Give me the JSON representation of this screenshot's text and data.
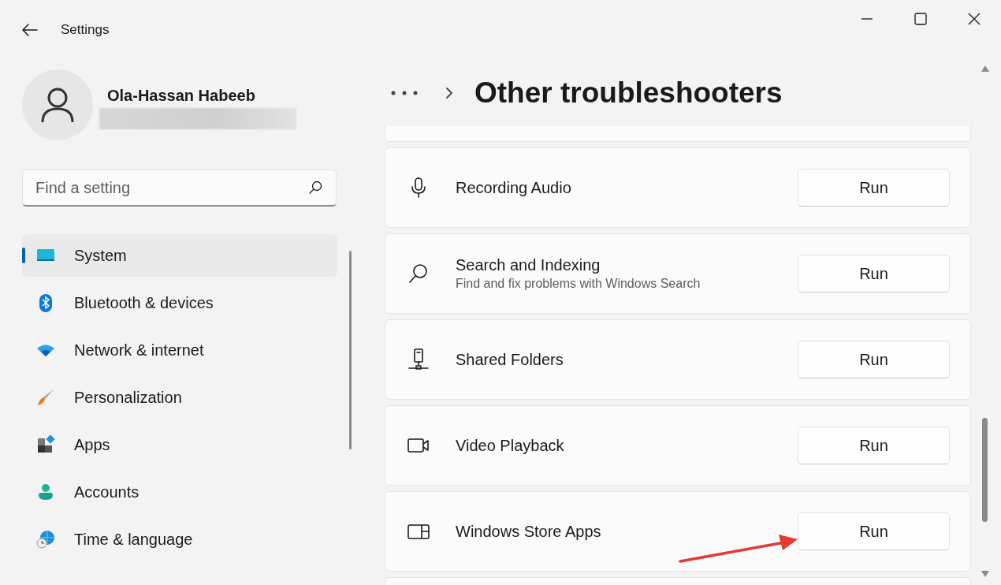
{
  "window": {
    "title": "Settings"
  },
  "profile": {
    "name": "Ola-Hassan Habeeb"
  },
  "search": {
    "placeholder": "Find a setting"
  },
  "nav": [
    {
      "kind": "system",
      "label": "System",
      "selected": true
    },
    {
      "kind": "bluetooth",
      "label": "Bluetooth & devices",
      "selected": false
    },
    {
      "kind": "network",
      "label": "Network & internet",
      "selected": false
    },
    {
      "kind": "personalization",
      "label": "Personalization",
      "selected": false
    },
    {
      "kind": "apps",
      "label": "Apps",
      "selected": false
    },
    {
      "kind": "accounts",
      "label": "Accounts",
      "selected": false
    },
    {
      "kind": "time",
      "label": "Time & language",
      "selected": false
    }
  ],
  "page_title": "Other troubleshooters",
  "troubleshooters": [
    {
      "kind": "microphone",
      "title": "Recording Audio",
      "button": "Run"
    },
    {
      "kind": "search",
      "title": "Search and Indexing",
      "description": "Find and fix problems with Windows Search",
      "button": "Run"
    },
    {
      "kind": "shared",
      "title": "Shared Folders",
      "button": "Run"
    },
    {
      "kind": "video",
      "title": "Video Playback",
      "button": "Run"
    },
    {
      "kind": "store",
      "title": "Windows Store Apps",
      "button": "Run"
    }
  ]
}
